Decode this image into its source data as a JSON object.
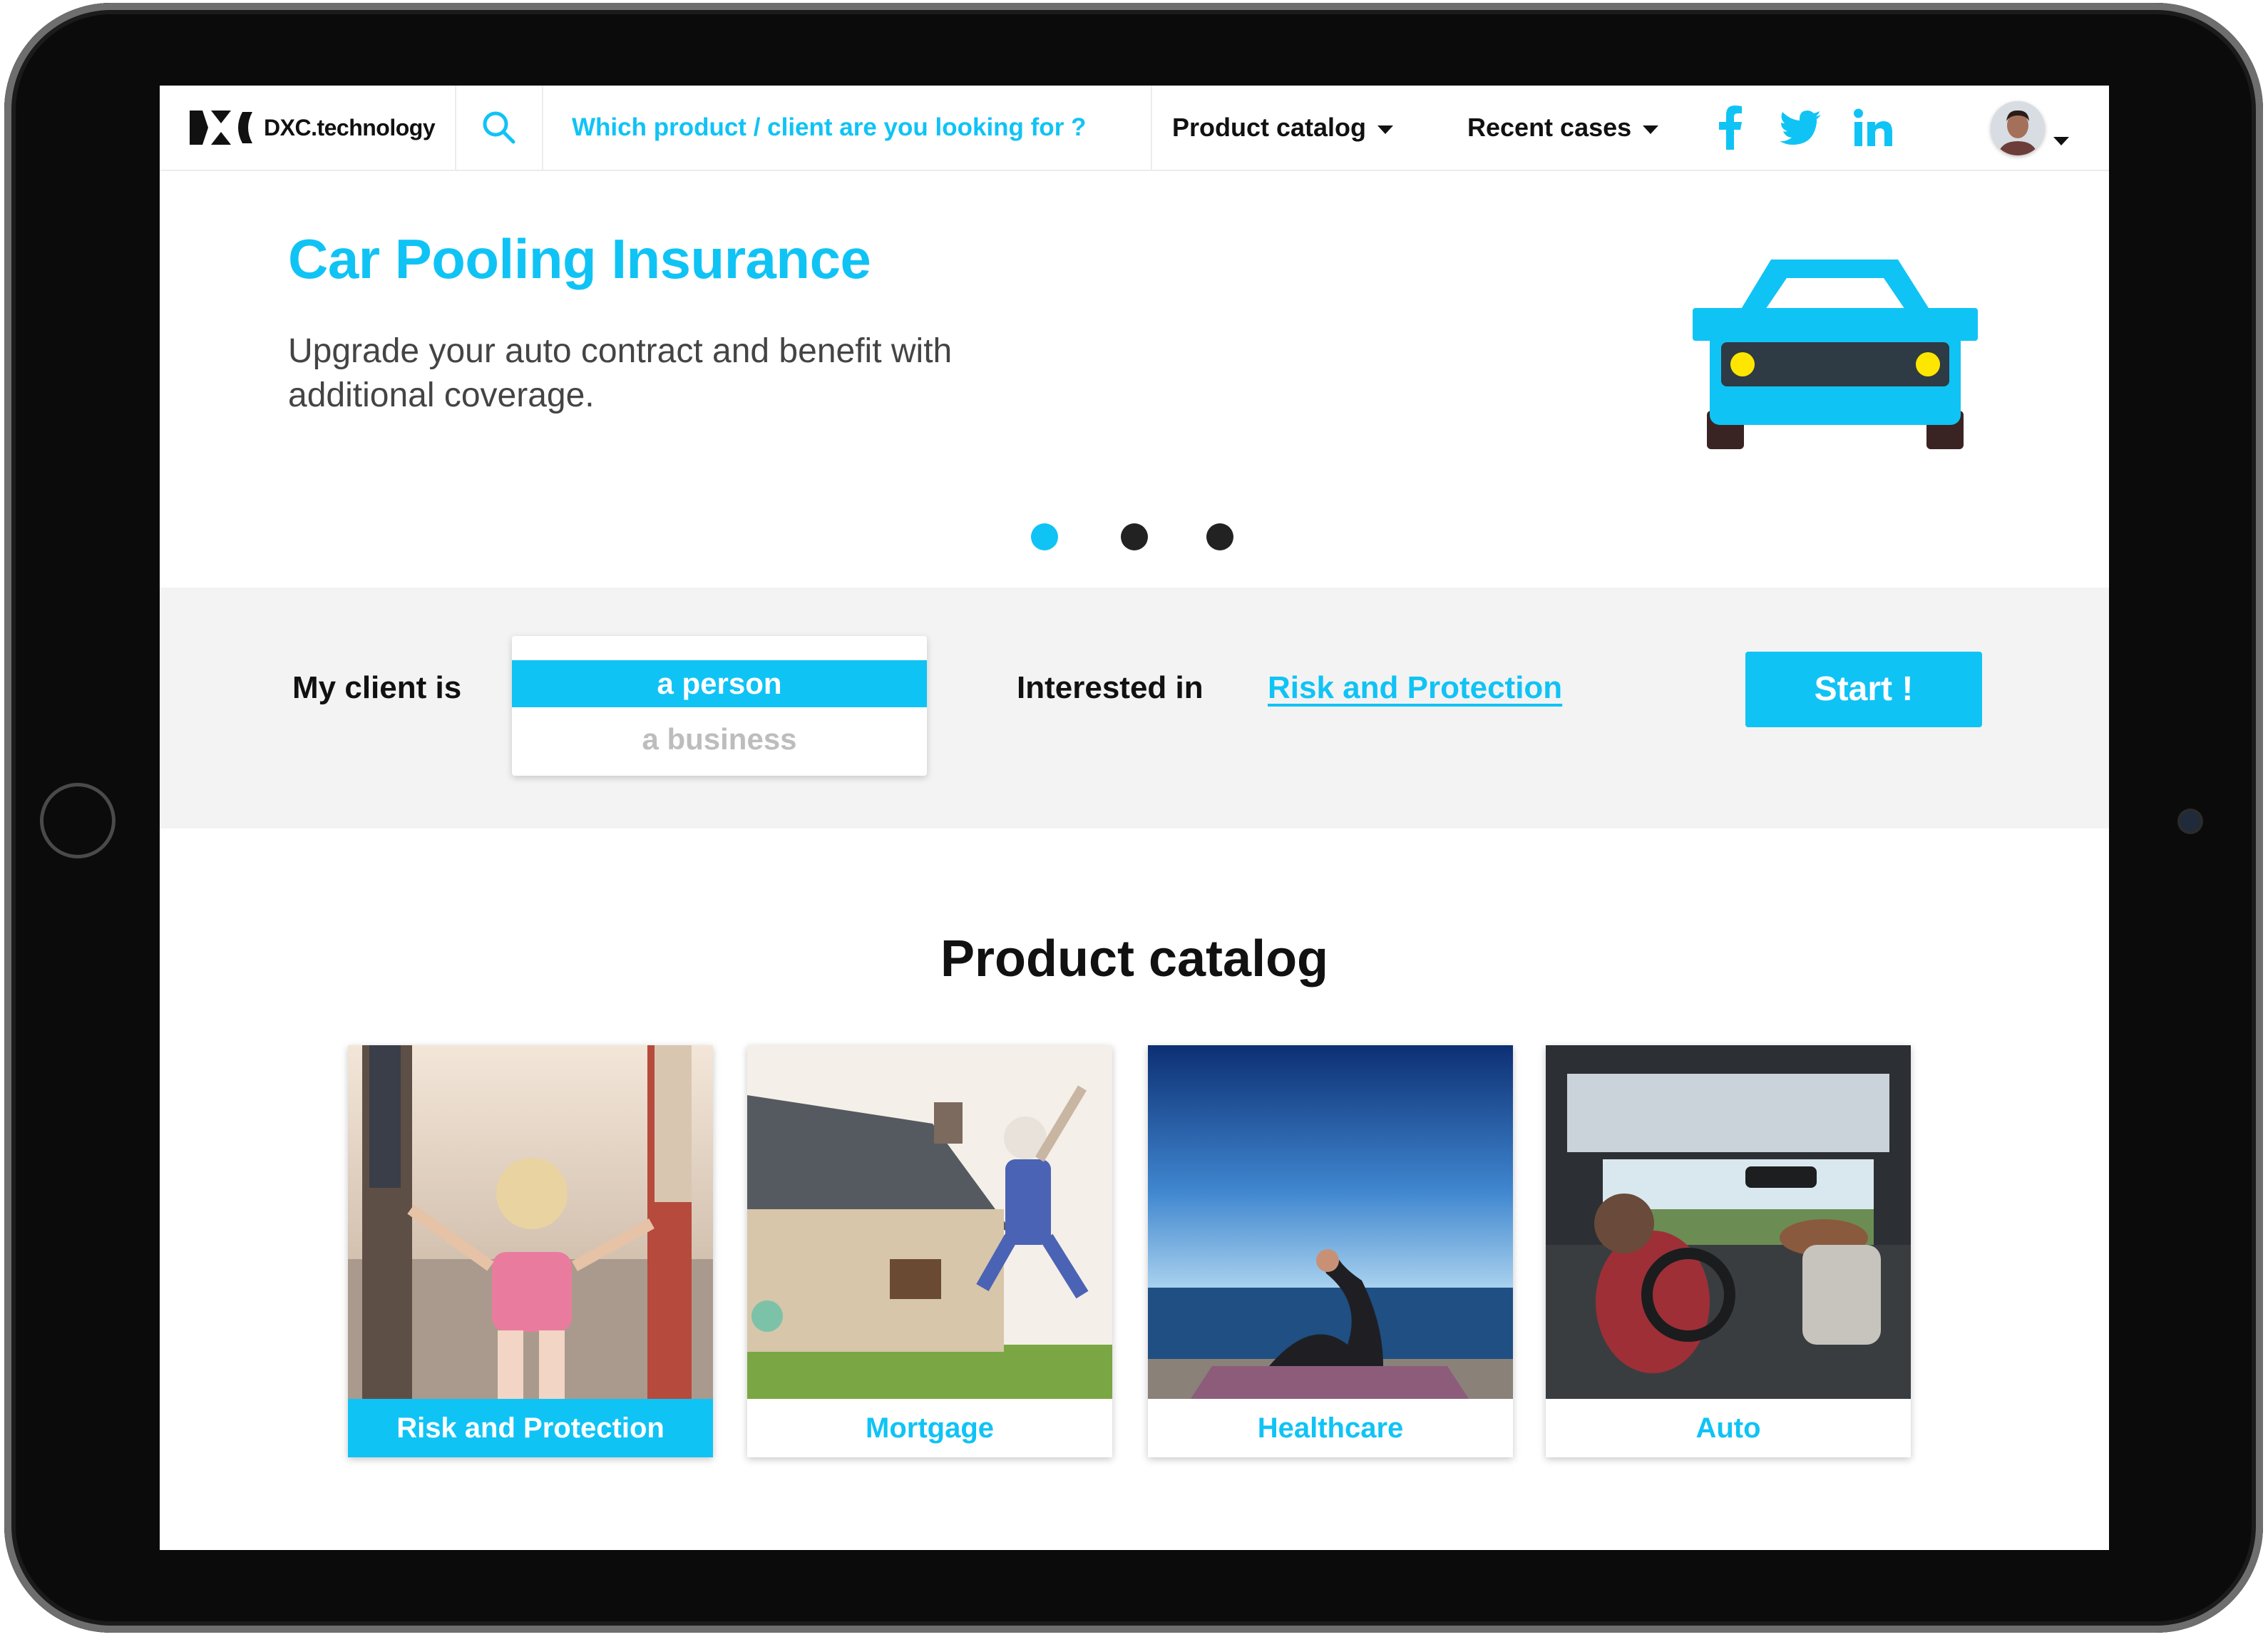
{
  "colors": {
    "accent": "#10c3f5",
    "text_dark": "#111111",
    "band_bg": "#f3f3f3",
    "car_body": "#10c3f5",
    "car_lights": "#ffe600"
  },
  "header": {
    "logo_text": "DXC.technology",
    "search_icon": "search-icon",
    "search_prompt": "Which product / client are you looking for ?",
    "nav": [
      {
        "label": "Product catalog",
        "icon": "caret-down-icon"
      },
      {
        "label": "Recent cases",
        "icon": "caret-down-icon"
      }
    ],
    "social": [
      {
        "name": "facebook-icon",
        "glyph": "f"
      },
      {
        "name": "twitter-icon",
        "glyph": "bird"
      },
      {
        "name": "linkedin-icon",
        "glyph": "in"
      }
    ],
    "avatar_icon": "user-avatar"
  },
  "hero": {
    "title": "Car Pooling Insurance",
    "subtitle": "Upgrade your auto contract and benefit with additional coverage.",
    "illustration": "car-icon",
    "slides_total": 3,
    "active_slide": 1
  },
  "filter": {
    "client_label": "My client is",
    "client_options": [
      "a person",
      "a business"
    ],
    "client_selected": "a person",
    "interest_label": "Interested in",
    "interest_value": "Risk and Protection",
    "start_label": "Start !"
  },
  "catalog": {
    "title": "Product catalog",
    "cards": [
      {
        "label": "Risk and Protection",
        "image": "family-walking-photo",
        "active": true
      },
      {
        "label": "Mortgage",
        "image": "house-jump-photo",
        "active": false
      },
      {
        "label": "Healthcare",
        "image": "yoga-sea-photo",
        "active": false
      },
      {
        "label": "Auto",
        "image": "car-interior-photo",
        "active": false
      }
    ]
  }
}
